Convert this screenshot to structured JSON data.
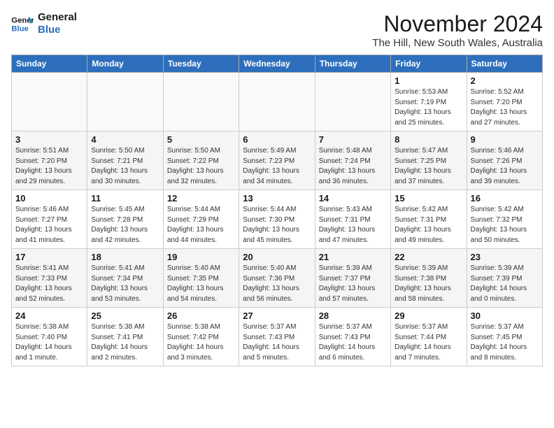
{
  "header": {
    "logo_line1": "General",
    "logo_line2": "Blue",
    "month_year": "November 2024",
    "location": "The Hill, New South Wales, Australia"
  },
  "days_of_week": [
    "Sunday",
    "Monday",
    "Tuesday",
    "Wednesday",
    "Thursday",
    "Friday",
    "Saturday"
  ],
  "weeks": [
    [
      {
        "day": "",
        "info": ""
      },
      {
        "day": "",
        "info": ""
      },
      {
        "day": "",
        "info": ""
      },
      {
        "day": "",
        "info": ""
      },
      {
        "day": "",
        "info": ""
      },
      {
        "day": "1",
        "info": "Sunrise: 5:53 AM\nSunset: 7:19 PM\nDaylight: 13 hours\nand 25 minutes."
      },
      {
        "day": "2",
        "info": "Sunrise: 5:52 AM\nSunset: 7:20 PM\nDaylight: 13 hours\nand 27 minutes."
      }
    ],
    [
      {
        "day": "3",
        "info": "Sunrise: 5:51 AM\nSunset: 7:20 PM\nDaylight: 13 hours\nand 29 minutes."
      },
      {
        "day": "4",
        "info": "Sunrise: 5:50 AM\nSunset: 7:21 PM\nDaylight: 13 hours\nand 30 minutes."
      },
      {
        "day": "5",
        "info": "Sunrise: 5:50 AM\nSunset: 7:22 PM\nDaylight: 13 hours\nand 32 minutes."
      },
      {
        "day": "6",
        "info": "Sunrise: 5:49 AM\nSunset: 7:23 PM\nDaylight: 13 hours\nand 34 minutes."
      },
      {
        "day": "7",
        "info": "Sunrise: 5:48 AM\nSunset: 7:24 PM\nDaylight: 13 hours\nand 36 minutes."
      },
      {
        "day": "8",
        "info": "Sunrise: 5:47 AM\nSunset: 7:25 PM\nDaylight: 13 hours\nand 37 minutes."
      },
      {
        "day": "9",
        "info": "Sunrise: 5:46 AM\nSunset: 7:26 PM\nDaylight: 13 hours\nand 39 minutes."
      }
    ],
    [
      {
        "day": "10",
        "info": "Sunrise: 5:46 AM\nSunset: 7:27 PM\nDaylight: 13 hours\nand 41 minutes."
      },
      {
        "day": "11",
        "info": "Sunrise: 5:45 AM\nSunset: 7:28 PM\nDaylight: 13 hours\nand 42 minutes."
      },
      {
        "day": "12",
        "info": "Sunrise: 5:44 AM\nSunset: 7:29 PM\nDaylight: 13 hours\nand 44 minutes."
      },
      {
        "day": "13",
        "info": "Sunrise: 5:44 AM\nSunset: 7:30 PM\nDaylight: 13 hours\nand 45 minutes."
      },
      {
        "day": "14",
        "info": "Sunrise: 5:43 AM\nSunset: 7:31 PM\nDaylight: 13 hours\nand 47 minutes."
      },
      {
        "day": "15",
        "info": "Sunrise: 5:42 AM\nSunset: 7:31 PM\nDaylight: 13 hours\nand 49 minutes."
      },
      {
        "day": "16",
        "info": "Sunrise: 5:42 AM\nSunset: 7:32 PM\nDaylight: 13 hours\nand 50 minutes."
      }
    ],
    [
      {
        "day": "17",
        "info": "Sunrise: 5:41 AM\nSunset: 7:33 PM\nDaylight: 13 hours\nand 52 minutes."
      },
      {
        "day": "18",
        "info": "Sunrise: 5:41 AM\nSunset: 7:34 PM\nDaylight: 13 hours\nand 53 minutes."
      },
      {
        "day": "19",
        "info": "Sunrise: 5:40 AM\nSunset: 7:35 PM\nDaylight: 13 hours\nand 54 minutes."
      },
      {
        "day": "20",
        "info": "Sunrise: 5:40 AM\nSunset: 7:36 PM\nDaylight: 13 hours\nand 56 minutes."
      },
      {
        "day": "21",
        "info": "Sunrise: 5:39 AM\nSunset: 7:37 PM\nDaylight: 13 hours\nand 57 minutes."
      },
      {
        "day": "22",
        "info": "Sunrise: 5:39 AM\nSunset: 7:38 PM\nDaylight: 13 hours\nand 58 minutes."
      },
      {
        "day": "23",
        "info": "Sunrise: 5:39 AM\nSunset: 7:39 PM\nDaylight: 14 hours\nand 0 minutes."
      }
    ],
    [
      {
        "day": "24",
        "info": "Sunrise: 5:38 AM\nSunset: 7:40 PM\nDaylight: 14 hours\nand 1 minute."
      },
      {
        "day": "25",
        "info": "Sunrise: 5:38 AM\nSunset: 7:41 PM\nDaylight: 14 hours\nand 2 minutes."
      },
      {
        "day": "26",
        "info": "Sunrise: 5:38 AM\nSunset: 7:42 PM\nDaylight: 14 hours\nand 3 minutes."
      },
      {
        "day": "27",
        "info": "Sunrise: 5:37 AM\nSunset: 7:43 PM\nDaylight: 14 hours\nand 5 minutes."
      },
      {
        "day": "28",
        "info": "Sunrise: 5:37 AM\nSunset: 7:43 PM\nDaylight: 14 hours\nand 6 minutes."
      },
      {
        "day": "29",
        "info": "Sunrise: 5:37 AM\nSunset: 7:44 PM\nDaylight: 14 hours\nand 7 minutes."
      },
      {
        "day": "30",
        "info": "Sunrise: 5:37 AM\nSunset: 7:45 PM\nDaylight: 14 hours\nand 8 minutes."
      }
    ]
  ]
}
